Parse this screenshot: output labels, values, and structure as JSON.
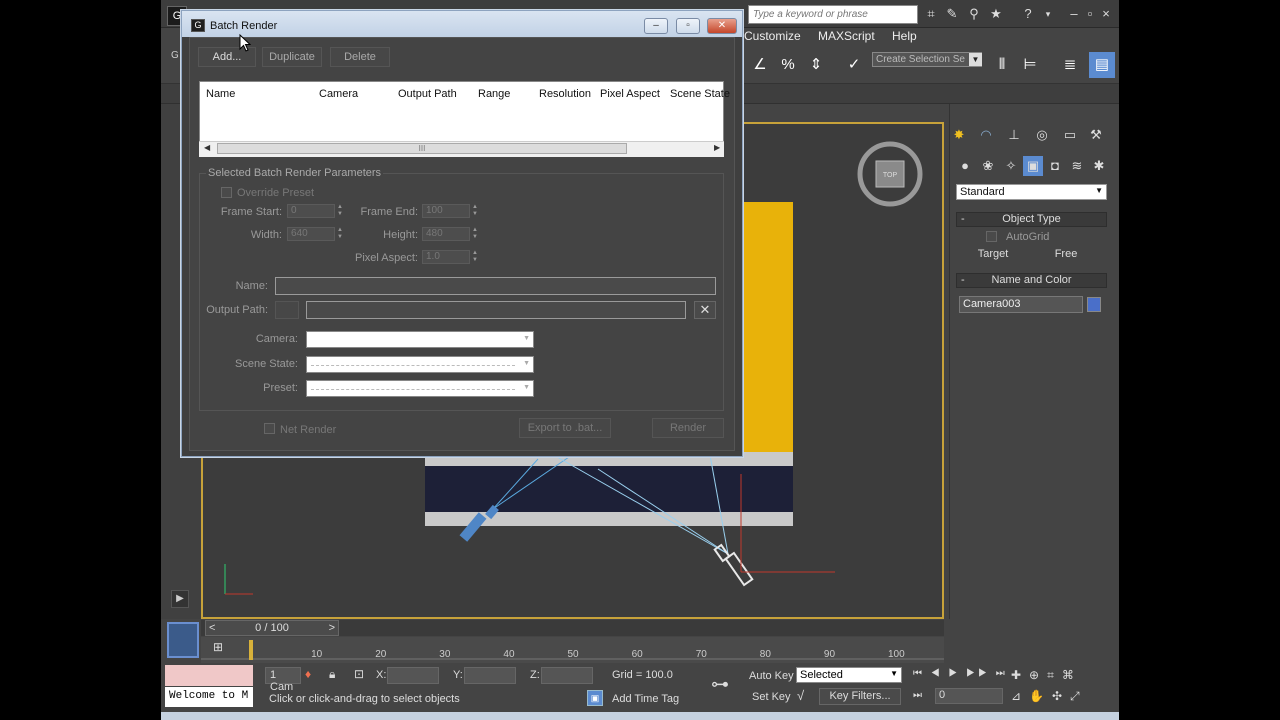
{
  "app": {
    "search_placeholder": "Type a keyword or phrase",
    "menus": [
      "Customize",
      "MAXScript",
      "Help"
    ],
    "selection_set_placeholder": "Create Selection Se",
    "command_panel": {
      "dropdown_value": "Standard",
      "object_type_title": "Object Type",
      "autogrid_label": "AutoGrid",
      "target_label": "Target",
      "free_label": "Free",
      "name_color_title": "Name and Color",
      "object_name": "Camera003",
      "object_color": "#4a6fc9"
    },
    "viewport": {
      "compass_label": "TOP"
    },
    "timeline": {
      "slider_label": "0 / 100",
      "ticks": [
        "10",
        "20",
        "30",
        "40",
        "50",
        "60",
        "70",
        "80",
        "90",
        "100"
      ]
    },
    "status": {
      "listener_text": "Welcome to M",
      "selection_count": "1 Cam",
      "prompt": "Click or click-and-drag to select objects",
      "x_label": "X:",
      "y_label": "Y:",
      "z_label": "Z:",
      "grid": "Grid = 100.0",
      "add_time_tag": "Add Time Tag",
      "auto_key": "Auto Key",
      "auto_key_value": "Selected",
      "set_key": "Set Key",
      "key_filters": "Key Filters...",
      "frame_value": "0"
    }
  },
  "dialog": {
    "title": "Batch Render",
    "buttons": {
      "add": "Add...",
      "duplicate": "Duplicate",
      "delete": "Delete"
    },
    "columns": [
      "Name",
      "Camera",
      "Output Path",
      "Range",
      "Resolution",
      "Pixel Aspect",
      "Scene State"
    ],
    "params_title": "Selected Batch Render Parameters",
    "override_preset": "Override Preset",
    "frame_start_label": "Frame Start:",
    "frame_start_value": "0",
    "frame_end_label": "Frame End:",
    "frame_end_value": "100",
    "width_label": "Width:",
    "width_value": "640",
    "height_label": "Height:",
    "height_value": "480",
    "pixel_aspect_label": "Pixel Aspect:",
    "pixel_aspect_value": "1.0",
    "name_label": "Name:",
    "output_path_label": "Output Path:",
    "camera_label": "Camera:",
    "scene_state_label": "Scene State:",
    "preset_label": "Preset:",
    "net_render_label": "Net Render",
    "export_button": "Export to .bat...",
    "render_button": "Render"
  }
}
